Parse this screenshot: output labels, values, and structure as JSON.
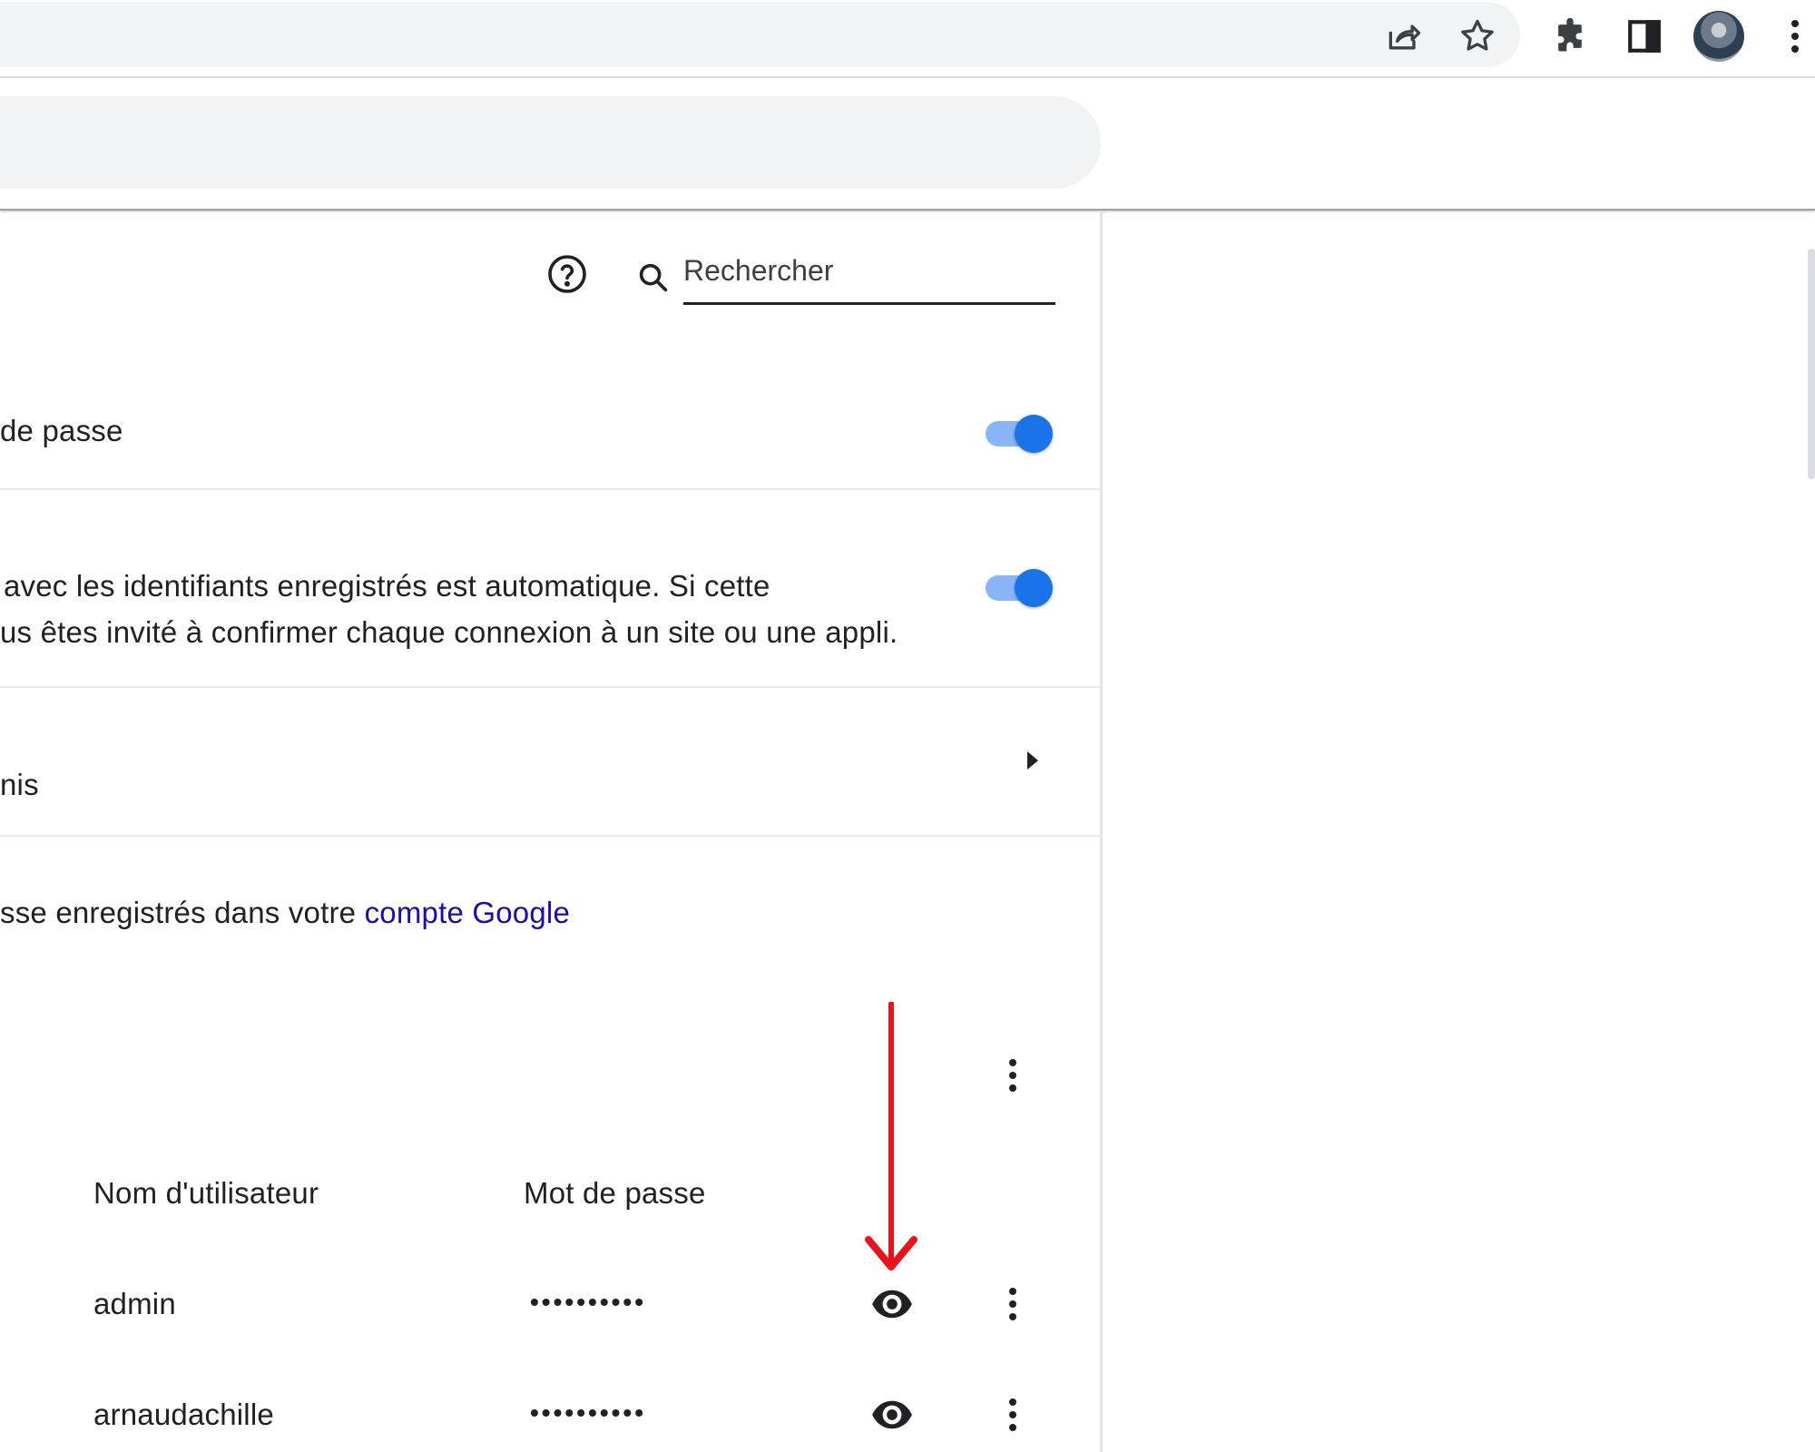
{
  "search": {
    "placeholder": "Rechercher"
  },
  "settings": [
    {
      "label": "de passe",
      "toggle_on": true
    },
    {
      "description_line1": "avec les identifiants enregistrés est automatique. Si cette",
      "description_line2": "us êtes invité à confirmer chaque connexion à un site ou une appli.",
      "toggle_on": true
    },
    {
      "label": "nis"
    }
  ],
  "account_note": {
    "text": "sse enregistrés dans votre ",
    "link": "compte Google"
  },
  "table": {
    "columns": [
      "Nom d'utilisateur",
      "Mot de passe"
    ],
    "rows": [
      {
        "username": "admin",
        "password_masked": "••••••••••"
      },
      {
        "username": "arnaudachille",
        "password_masked": "••••••••••"
      }
    ]
  },
  "colors": {
    "accent": "#1a73e8",
    "link": "#1a0dab",
    "annotation_arrow": "#e8131b"
  },
  "icons": [
    "share-icon",
    "star-icon",
    "puzzle-icon",
    "side-panel-icon",
    "avatar",
    "menu-icon",
    "help-icon",
    "search-icon",
    "chevron-right-icon",
    "eye-icon",
    "kebab-icon"
  ]
}
